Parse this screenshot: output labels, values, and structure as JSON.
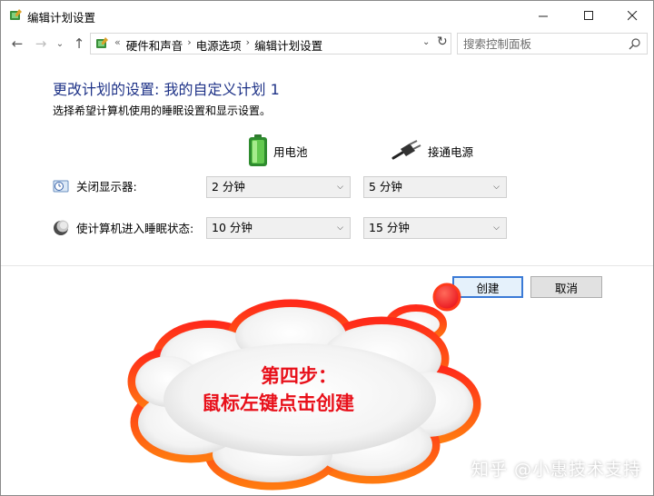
{
  "window": {
    "title": "编辑计划设置",
    "min_icon": "minimize-icon",
    "max_icon": "maximize-icon",
    "close_icon": "close-icon"
  },
  "navbar": {
    "breadcrumb_lead": "«",
    "breadcrumbs": [
      "硬件和声音",
      "电源选项",
      "编辑计划设置"
    ],
    "search_placeholder": "搜索控制面板"
  },
  "content": {
    "heading": "更改计划的设置: 我的自定义计划 1",
    "subheading": "选择希望计算机使用的睡眠设置和显示设置。",
    "columns": {
      "battery": "用电池",
      "plugged": "接通电源"
    },
    "rows": [
      {
        "label": "关闭显示器:",
        "battery": "2 分钟",
        "plugged": "5 分钟"
      },
      {
        "label": "使计算机进入睡眠状态:",
        "battery": "10 分钟",
        "plugged": "15 分钟"
      }
    ]
  },
  "buttons": {
    "create": "创建",
    "cancel": "取消"
  },
  "annotation": {
    "line1": "第四步：",
    "line2": "鼠标左键点击创建",
    "text_color": "#e8101a",
    "outline_color": "#ff3a1a"
  },
  "watermark": "知乎 @小惠技术支持"
}
